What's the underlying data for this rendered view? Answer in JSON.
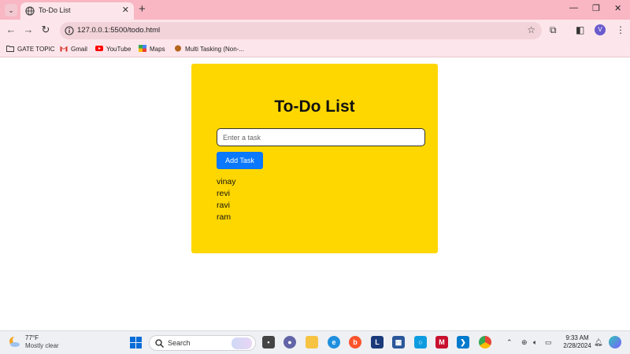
{
  "browser": {
    "tab_title": "To-Do List",
    "tab_close": "✕",
    "new_tab": "+",
    "url": "127.0.0.1:5500/todo.html",
    "profile_initial": "V",
    "bookmarks": [
      {
        "label": "GATE TOPIC",
        "icon": "folder-icon"
      },
      {
        "label": "Gmail",
        "icon": "gmail-icon"
      },
      {
        "label": "YouTube",
        "icon": "youtube-icon"
      },
      {
        "label": "Maps",
        "icon": "maps-icon"
      },
      {
        "label": "Multi Tasking (Non-...",
        "icon": "bookmark-favicon-icon"
      }
    ],
    "window_controls": {
      "minimize": "—",
      "maximize": "❐",
      "close": "✕"
    }
  },
  "app": {
    "title": "To-Do List",
    "input_placeholder": "Enter a task",
    "add_button_label": "Add Task",
    "tasks": [
      "vinay",
      "revi",
      "ravi",
      "ram"
    ]
  },
  "taskbar": {
    "weather_temp": "77°F",
    "weather_desc": "Mostly clear",
    "search_label": "Search",
    "time": "9:33 AM",
    "date": "2/28/2024"
  },
  "colors": {
    "card_background": "#ffd700",
    "button_blue": "#0a78ff",
    "browser_chrome_pink": "#f8b7c3"
  }
}
